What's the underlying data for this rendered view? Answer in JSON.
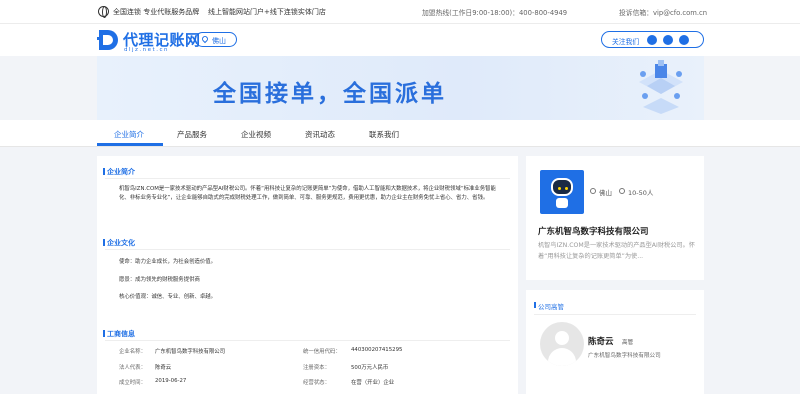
{
  "topbar": {
    "slogan": "全国连锁 专业代账服务品牌",
    "tagline": "线上智能网站门户+线下连锁实体门店",
    "hotline": "加盟热线(工作日9:00-18:00)：400-800-4949",
    "complaint": "投诉信箱：vip@cfo.com.cn"
  },
  "header": {
    "logo_name": "代理记账网",
    "logo_sub": "dljz.net.cn",
    "city": "佛山",
    "follow_label": "关注我们",
    "follow_icons": [
      "weibo-icon",
      "wechat-icon",
      "qq-icon"
    ]
  },
  "banner": {
    "slogan": "全国接单，全国派单"
  },
  "tabs": [
    "企业简介",
    "产品服务",
    "企业视频",
    "资讯动态",
    "联系我们"
  ],
  "sections": {
    "intro": {
      "title": "企业简介",
      "text": "机智鸟IZN.COM是一家技术驱动的产品型AI财税公司。怀着“用科技让复杂的记账更简单”为使命，借助人工智能和大数据技术，将企业财税领域“标准业务智能化、非标业务专业化”，让企业能够自助式的完成财税处理工作，做到简单、可靠、服务更规范，费用更优惠，助力企业主在财务免忧上省心、省力、省钱。"
    },
    "culture": {
      "title": "企业文化",
      "mission": "使命：助力企业成长，为社会创造价值。",
      "vision": "愿景：成为领先的财税服务提供商",
      "values": "核心价值观：诚信、专业、创新、卓越。"
    },
    "business": {
      "title": "工商信息",
      "rows": [
        {
          "label": "企业名称：",
          "value": "广东机智鸟数字科技有限公司",
          "label2": "统一信用代码：",
          "value2": "440300207415295"
        },
        {
          "label": "法人代表：",
          "value": "陈奇云",
          "label2": "注册资本：",
          "value2": "500万元人民币"
        },
        {
          "label": "成立时间：",
          "value": "2019-06-27",
          "label2": "经营状态：",
          "value2": "在营（开业）企业"
        }
      ]
    }
  },
  "profile": {
    "city": "佛山",
    "size": "10-50人",
    "company_name": "广东机智鸟数字科技有限公司",
    "intro": "机智鸟IZN.COM是一家技术驱动的产品型AI财税公司。怀着“用科技让复杂的记账更简单”为使..."
  },
  "executives": {
    "title": "公司高管",
    "name": "陈奇云",
    "role": "高管",
    "company": "广东机智鸟数字科技有限公司"
  }
}
